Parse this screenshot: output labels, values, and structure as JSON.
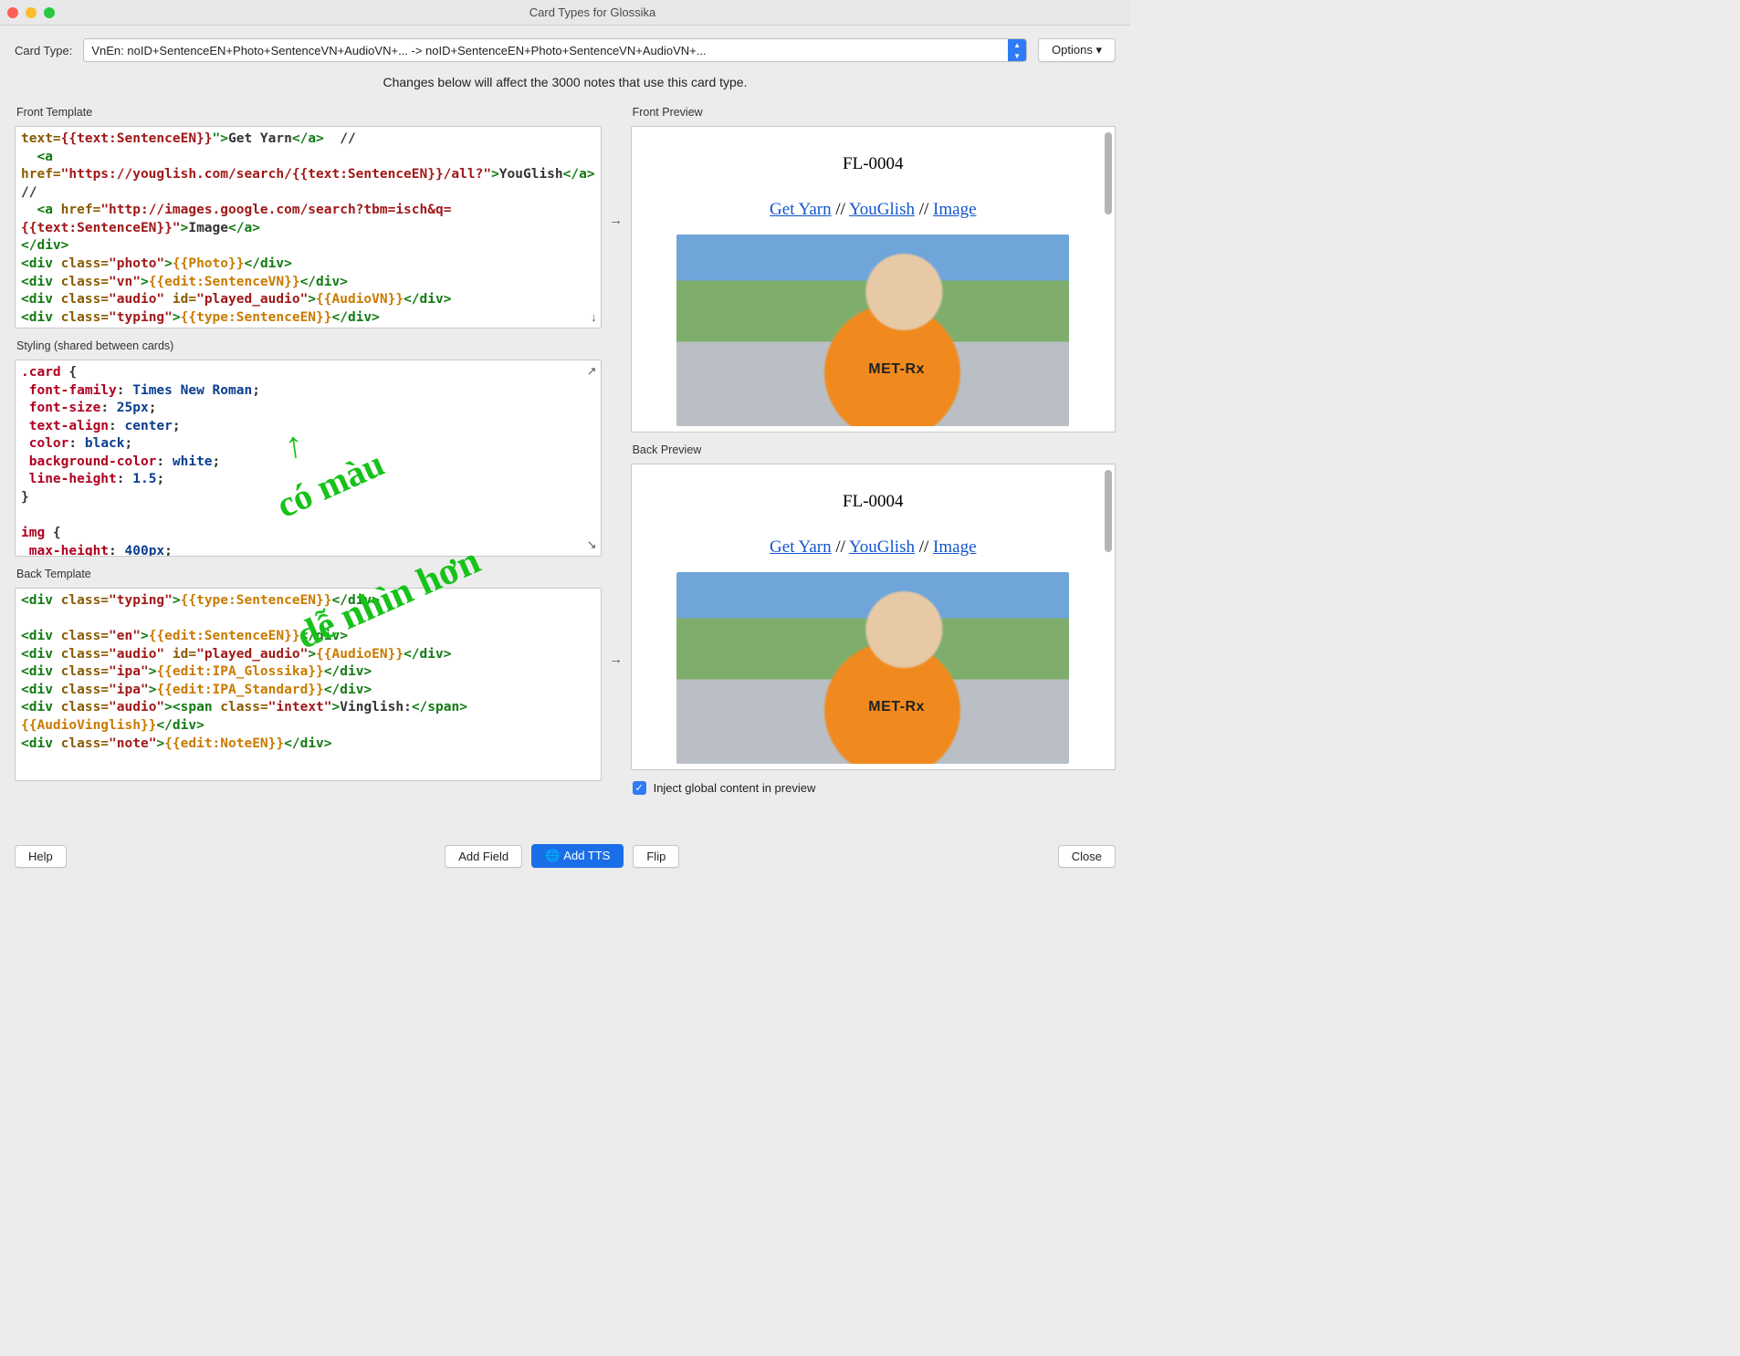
{
  "window": {
    "title": "Card Types for Glossika"
  },
  "top": {
    "cardtype_label": "Card Type:",
    "combo_text": "VnEn: noID+SentenceEN+Photo+SentenceVN+AudioVN+... -> noID+SentenceEN+Photo+SentenceVN+AudioVN+...",
    "options_label": "Options ▾"
  },
  "info_line": "Changes below will affect the 3000 notes that use this card type.",
  "labels": {
    "front_template": "Front Template",
    "styling": "Styling (shared between cards)",
    "back_template": "Back Template",
    "front_preview": "Front Preview",
    "back_preview": "Back Preview"
  },
  "front_template_tokens": [
    [
      "t-attr",
      "text="
    ],
    [
      "t-str",
      "{{text:SentenceEN}}"
    ],
    [
      "t-punc",
      "\">"
    ],
    [
      "t-text",
      "Get Yarn"
    ],
    [
      "t-punc",
      "</"
    ],
    [
      "t-tag",
      "a"
    ],
    [
      "t-punc",
      ">"
    ],
    [
      "t-text",
      "  //\n"
    ],
    [
      "t-text",
      "  "
    ],
    [
      "t-punc",
      "<"
    ],
    [
      "t-tag",
      "a "
    ],
    [
      "t-attr",
      "href="
    ],
    [
      "t-str",
      "\"https://youglish.com/search/{{text:SentenceEN}}/all?\""
    ],
    [
      "t-punc",
      ">"
    ],
    [
      "t-text",
      "YouGlish"
    ],
    [
      "t-punc",
      "</"
    ],
    [
      "t-tag",
      "a"
    ],
    [
      "t-punc",
      ">"
    ],
    [
      "t-text",
      "  //\n"
    ],
    [
      "t-text",
      "  "
    ],
    [
      "t-punc",
      "<"
    ],
    [
      "t-tag",
      "a "
    ],
    [
      "t-attr",
      "href="
    ],
    [
      "t-str",
      "\"http://images.google.com/search?tbm=isch&q={{text:SentenceEN}}\""
    ],
    [
      "t-punc",
      ">"
    ],
    [
      "t-text",
      "Image"
    ],
    [
      "t-punc",
      "</"
    ],
    [
      "t-tag",
      "a"
    ],
    [
      "t-punc",
      ">\n"
    ],
    [
      "t-punc",
      "</"
    ],
    [
      "t-tag",
      "div"
    ],
    [
      "t-punc",
      ">\n"
    ],
    [
      "t-punc",
      "<"
    ],
    [
      "t-tag",
      "div "
    ],
    [
      "t-attr",
      "class="
    ],
    [
      "t-str",
      "\"photo\""
    ],
    [
      "t-punc",
      ">"
    ],
    [
      "t-field",
      "{{Photo}}"
    ],
    [
      "t-punc",
      "</"
    ],
    [
      "t-tag",
      "div"
    ],
    [
      "t-punc",
      ">\n"
    ],
    [
      "t-punc",
      "<"
    ],
    [
      "t-tag",
      "div "
    ],
    [
      "t-attr",
      "class="
    ],
    [
      "t-str",
      "\"vn\""
    ],
    [
      "t-punc",
      ">"
    ],
    [
      "t-field",
      "{{edit:SentenceVN}}"
    ],
    [
      "t-punc",
      "</"
    ],
    [
      "t-tag",
      "div"
    ],
    [
      "t-punc",
      ">\n"
    ],
    [
      "t-punc",
      "<"
    ],
    [
      "t-tag",
      "div "
    ],
    [
      "t-attr",
      "class="
    ],
    [
      "t-str",
      "\"audio\""
    ],
    [
      "t-text",
      " "
    ],
    [
      "t-attr",
      "id="
    ],
    [
      "t-str",
      "\"played_audio\""
    ],
    [
      "t-punc",
      ">"
    ],
    [
      "t-field",
      "{{AudioVN}}"
    ],
    [
      "t-punc",
      "</"
    ],
    [
      "t-tag",
      "div"
    ],
    [
      "t-punc",
      ">\n"
    ],
    [
      "t-punc",
      "<"
    ],
    [
      "t-tag",
      "div "
    ],
    [
      "t-attr",
      "class="
    ],
    [
      "t-str",
      "\"typing\""
    ],
    [
      "t-punc",
      ">"
    ],
    [
      "t-field",
      "{{type:SentenceEN}}"
    ],
    [
      "t-punc",
      "</"
    ],
    [
      "t-tag",
      "div"
    ],
    [
      "t-punc",
      ">"
    ]
  ],
  "styling_tokens": [
    [
      "t-sel",
      ".card"
    ],
    [
      "t-text",
      " {\n"
    ],
    [
      "t-prop",
      " font-family"
    ],
    [
      "t-text",
      ": "
    ],
    [
      "t-val",
      "Times New Roman"
    ],
    [
      "t-text",
      ";\n"
    ],
    [
      "t-prop",
      " font-size"
    ],
    [
      "t-text",
      ": "
    ],
    [
      "t-val",
      "25px"
    ],
    [
      "t-text",
      ";\n"
    ],
    [
      "t-prop",
      " text-align"
    ],
    [
      "t-text",
      ": "
    ],
    [
      "t-val",
      "center"
    ],
    [
      "t-text",
      ";\n"
    ],
    [
      "t-prop",
      " color"
    ],
    [
      "t-text",
      ": "
    ],
    [
      "t-val",
      "black"
    ],
    [
      "t-text",
      ";\n"
    ],
    [
      "t-prop",
      " background-color"
    ],
    [
      "t-text",
      ": "
    ],
    [
      "t-val",
      "white"
    ],
    [
      "t-text",
      ";\n"
    ],
    [
      "t-prop",
      " line-height"
    ],
    [
      "t-text",
      ": "
    ],
    [
      "t-val",
      "1.5"
    ],
    [
      "t-text",
      ";\n"
    ],
    [
      "t-text",
      "}\n\n"
    ],
    [
      "t-sel",
      "img"
    ],
    [
      "t-text",
      " {\n"
    ],
    [
      "t-prop",
      " max-height"
    ],
    [
      "t-text",
      ": "
    ],
    [
      "t-val",
      "400px"
    ],
    [
      "t-text",
      ";"
    ]
  ],
  "back_template_tokens": [
    [
      "t-punc",
      "<"
    ],
    [
      "t-tag",
      "div "
    ],
    [
      "t-attr",
      "class="
    ],
    [
      "t-str",
      "\"typing\""
    ],
    [
      "t-punc",
      ">"
    ],
    [
      "t-field",
      "{{type:SentenceEN}}"
    ],
    [
      "t-punc",
      "</"
    ],
    [
      "t-tag",
      "div"
    ],
    [
      "t-punc",
      ">\n\n"
    ],
    [
      "t-punc",
      "<"
    ],
    [
      "t-tag",
      "div "
    ],
    [
      "t-attr",
      "class="
    ],
    [
      "t-str",
      "\"en\""
    ],
    [
      "t-punc",
      ">"
    ],
    [
      "t-field",
      "{{edit:SentenceEN}}"
    ],
    [
      "t-punc",
      "</"
    ],
    [
      "t-tag",
      "div"
    ],
    [
      "t-punc",
      ">\n"
    ],
    [
      "t-punc",
      "<"
    ],
    [
      "t-tag",
      "div "
    ],
    [
      "t-attr",
      "class="
    ],
    [
      "t-str",
      "\"audio\""
    ],
    [
      "t-text",
      " "
    ],
    [
      "t-attr",
      "id="
    ],
    [
      "t-str",
      "\"played_audio\""
    ],
    [
      "t-punc",
      ">"
    ],
    [
      "t-field",
      "{{AudioEN}}"
    ],
    [
      "t-punc",
      "</"
    ],
    [
      "t-tag",
      "div"
    ],
    [
      "t-punc",
      ">\n"
    ],
    [
      "t-punc",
      "<"
    ],
    [
      "t-tag",
      "div "
    ],
    [
      "t-attr",
      "class="
    ],
    [
      "t-str",
      "\"ipa\""
    ],
    [
      "t-punc",
      ">"
    ],
    [
      "t-field",
      "{{edit:IPA_Glossika}}"
    ],
    [
      "t-punc",
      "</"
    ],
    [
      "t-tag",
      "div"
    ],
    [
      "t-punc",
      ">\n"
    ],
    [
      "t-punc",
      "<"
    ],
    [
      "t-tag",
      "div "
    ],
    [
      "t-attr",
      "class="
    ],
    [
      "t-str",
      "\"ipa\""
    ],
    [
      "t-punc",
      ">"
    ],
    [
      "t-field",
      "{{edit:IPA_Standard}}"
    ],
    [
      "t-punc",
      "</"
    ],
    [
      "t-tag",
      "div"
    ],
    [
      "t-punc",
      ">\n"
    ],
    [
      "t-punc",
      "<"
    ],
    [
      "t-tag",
      "div "
    ],
    [
      "t-attr",
      "class="
    ],
    [
      "t-str",
      "\"audio\""
    ],
    [
      "t-punc",
      "><"
    ],
    [
      "t-tag",
      "span "
    ],
    [
      "t-attr",
      "class="
    ],
    [
      "t-str",
      "\"intext\""
    ],
    [
      "t-punc",
      ">"
    ],
    [
      "t-text",
      "Vinglish:"
    ],
    [
      "t-punc",
      "</"
    ],
    [
      "t-tag",
      "span"
    ],
    [
      "t-punc",
      ">"
    ],
    [
      "t-field",
      "{{AudioVinglish}}"
    ],
    [
      "t-punc",
      "</"
    ],
    [
      "t-tag",
      "div"
    ],
    [
      "t-punc",
      ">\n"
    ],
    [
      "t-punc",
      "<"
    ],
    [
      "t-tag",
      "div "
    ],
    [
      "t-attr",
      "class="
    ],
    [
      "t-str",
      "\"note\""
    ],
    [
      "t-punc",
      ">"
    ],
    [
      "t-field",
      "{{edit:NoteEN}}"
    ],
    [
      "t-punc",
      "</"
    ],
    [
      "t-tag",
      "div"
    ],
    [
      "t-punc",
      ">"
    ]
  ],
  "preview": {
    "id": "FL-0004",
    "link1": "Get Yarn",
    "sep": " // ",
    "link2": "YouGlish",
    "link3": "Image"
  },
  "inject": {
    "label": "Inject global content in preview",
    "checked": true
  },
  "buttons": {
    "help": "Help",
    "add_field": "Add Field",
    "add_tts": "Add TTS",
    "flip": "Flip",
    "close": "Close"
  },
  "handwriting": {
    "arrow": "↑",
    "line1": "có màu",
    "line2": "dễ nhìn hơn"
  }
}
